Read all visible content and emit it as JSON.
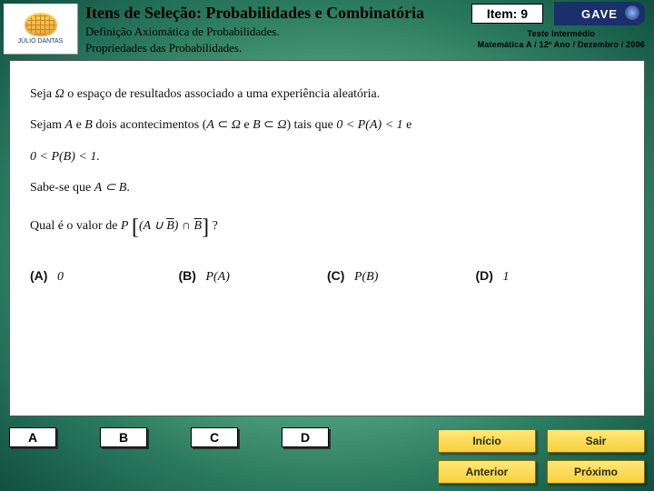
{
  "header": {
    "title": "Itens de Seleção: Probabilidades e Combinatória",
    "subtitle1": "Definição Axiomática de Probabilidades.",
    "subtitle2": "Propriedades das Probabilidades.",
    "item_label": "Item: 9",
    "gave": "GAVE",
    "meta1": "Teste Intermédio",
    "meta2": "Matemática A / 12º Ano / Dezembro / 2006",
    "logo_caption": "JÚLIO DANTAS"
  },
  "question": {
    "line1_a": "Seja ",
    "line1_b": " o espaço de resultados associado a uma experiência aleatória.",
    "line2_a": "Sejam ",
    "line2_b": " e ",
    "line2_c": " dois acontecimentos (",
    "line2_d": " e ",
    "line2_e": ") tais que ",
    "line2_f": " e",
    "line3": "0 < P(B) < 1.",
    "line4_a": "Sabe-se que ",
    "line5_a": "Qual é o valor de ",
    "line5_b": " ?",
    "omega": "Ω",
    "A": "A",
    "B": "B",
    "subset": "⊂",
    "cond_PA": "0 < P(A) < 1",
    "AsubB": "A ⊂ B",
    "expr": "(A ∪ B) ∩ B"
  },
  "options": {
    "A": {
      "label": "(A)",
      "value": "0"
    },
    "B": {
      "label": "(B)",
      "value": "P(A)"
    },
    "C": {
      "label": "(C)",
      "value": "P(B)"
    },
    "D": {
      "label": "(D)",
      "value": "1"
    }
  },
  "answers": {
    "A": "A",
    "B": "B",
    "C": "C",
    "D": "D"
  },
  "nav": {
    "inicio": "Início",
    "sair": "Sair",
    "anterior": "Anterior",
    "proximo": "Próximo"
  }
}
